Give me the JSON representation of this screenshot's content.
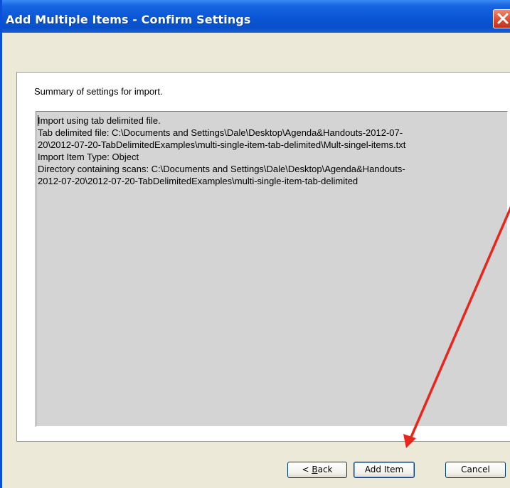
{
  "window": {
    "title": "Add Multiple Items - Confirm Settings"
  },
  "summary": {
    "label": "Summary of settings for import.",
    "lines": [
      "Import using tab delimited file.",
      "Tab delimited file: C:\\Documents and Settings\\Dale\\Desktop\\Agenda&Handouts-2012-07-",
      "20\\2012-07-20-TabDelimitedExamples\\multi-single-item-tab-delimited\\Mult-singel-items.txt",
      "Import Item Type: Object",
      "Directory containing scans: C:\\Documents and Settings\\Dale\\Desktop\\Agenda&Handouts-",
      "2012-07-20\\2012-07-20-TabDelimitedExamples\\multi-single-item-tab-delimited"
    ]
  },
  "buttons": {
    "back_prefix": "< ",
    "back_mnemonic": "B",
    "back_rest": "ack",
    "add_item": "Add Item",
    "cancel": "Cancel"
  },
  "colors": {
    "titlebar": "#0a56d6",
    "dialog_bg": "#ece9d8",
    "textbox_bg": "#d4d4d4",
    "annotation_arrow": "#e8261c"
  }
}
